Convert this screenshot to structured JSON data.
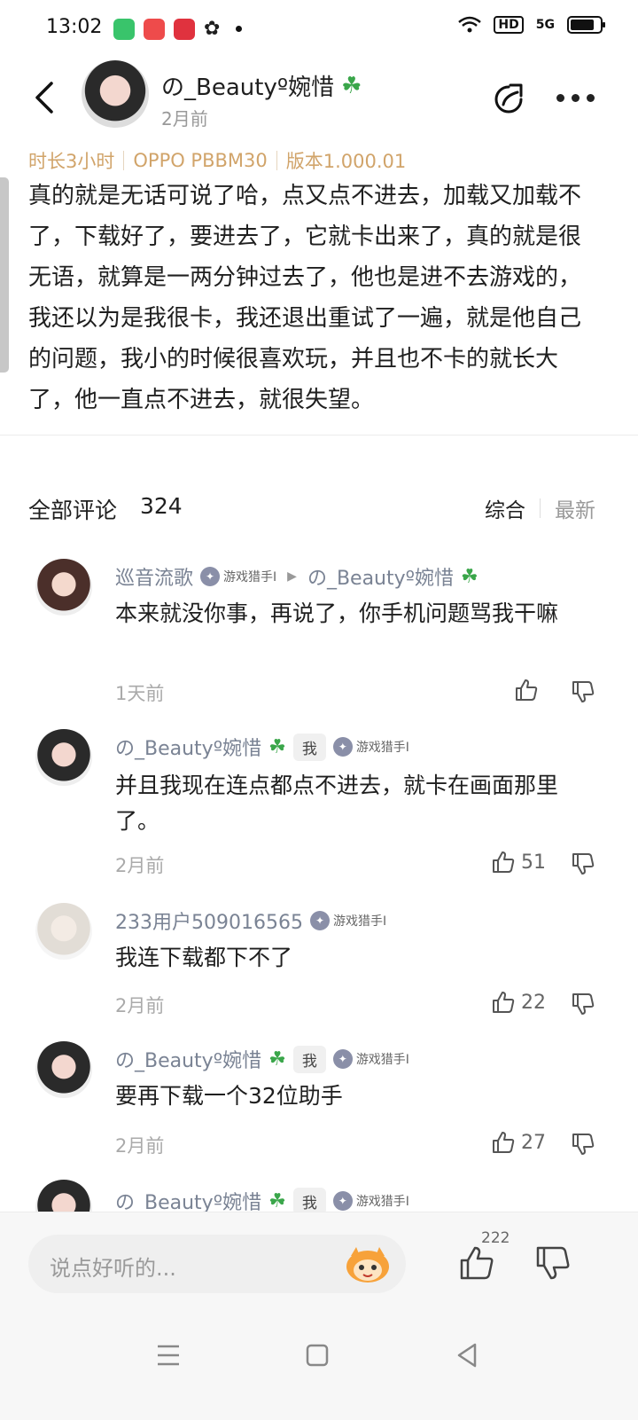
{
  "status_bar": {
    "time": "13:02",
    "right_labels": {
      "hd": "HD",
      "net": "5G"
    }
  },
  "post": {
    "author": "の_Beautyº婉惜",
    "posted": "2月前",
    "meta": [
      "时长3小时",
      "OPPO PBBM30",
      "版本1.000.01"
    ],
    "text": "真的就是无话可说了哈，点又点不进去，加载又加载不了，下载好了，要进去了，它就卡出来了，真的就是很无语，就算是一两分钟过去了，他也是进不去游戏的，我还以为是我很卡，我还退出重试了一遍，就是他自己的问题，我小的时候很喜欢玩，并且也不卡的就长大了，他一直点不进去，就很失望。"
  },
  "comments_header": {
    "title": "全部评论",
    "count": "324",
    "sort_options": [
      "综合",
      "最新"
    ]
  },
  "comments": [
    {
      "name": "巡音流歌",
      "badge": "游戏猎手Ⅰ",
      "reply_to": "の_Beautyº婉惜",
      "text": "本来就没你事，再说了，你手机问题骂我干嘛",
      "time": "1天前",
      "likes": ""
    },
    {
      "name": "の_Beautyº婉惜",
      "me": "我",
      "badge": "游戏猎手Ⅰ",
      "text": "并且我现在连点都点不进去，就卡在画面那里了。",
      "time": "2月前",
      "likes": "51"
    },
    {
      "name": "233用户509016565",
      "badge": "游戏猎手Ⅰ",
      "text": "我连下载都下不了",
      "time": "2月前",
      "likes": "22"
    },
    {
      "name": "の_Beautyº婉惜",
      "me": "我",
      "badge": "游戏猎手Ⅰ",
      "text": "要再下载一个32位助手",
      "time": "2月前",
      "likes": "27"
    },
    {
      "name": "の_Beautyº婉惜",
      "me": "我",
      "badge": "游戏猎手Ⅰ"
    }
  ],
  "bottom_bar": {
    "input_placeholder": "说点好听的...",
    "like_count": "222"
  },
  "colors": {
    "accent_meta": "#d1a46a",
    "name": "#7a8394",
    "clover": "#3aa64a"
  }
}
